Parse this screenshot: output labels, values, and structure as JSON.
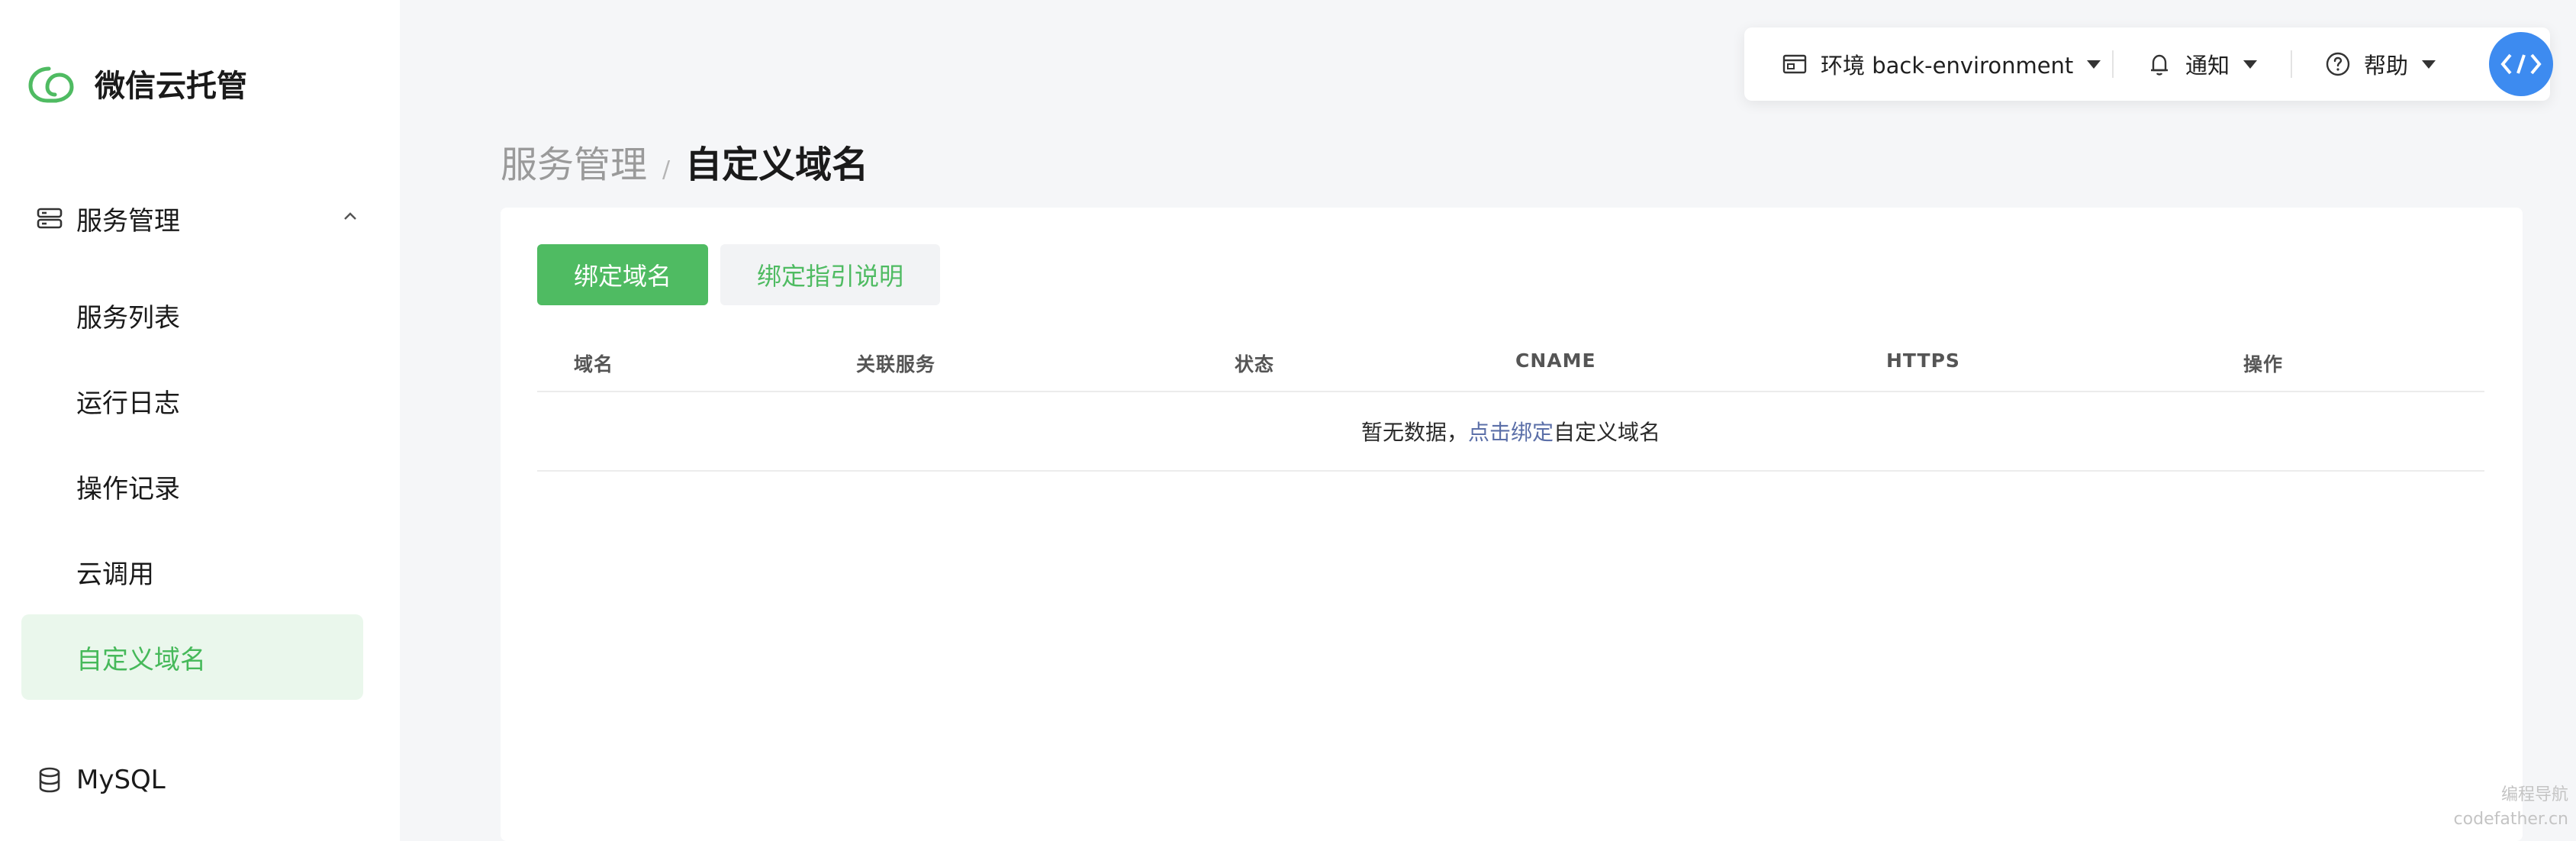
{
  "app": {
    "title": "微信云托管"
  },
  "colors": {
    "accent": "#4fbb62",
    "accent_bg": "#eaf7ec",
    "link": "#5b6fa8",
    "avatar": "#3d8bf0"
  },
  "sidebar": {
    "group": {
      "label": "服务管理",
      "icon": "server-icon",
      "expanded": true
    },
    "items": [
      {
        "label": "服务列表",
        "active": false
      },
      {
        "label": "运行日志",
        "active": false
      },
      {
        "label": "操作记录",
        "active": false
      },
      {
        "label": "云调用",
        "active": false
      },
      {
        "label": "自定义域名",
        "active": true
      }
    ],
    "mysql": {
      "label": "MySQL",
      "icon": "database-icon"
    }
  },
  "topbar": {
    "environment": {
      "label": "环境 back-environment",
      "icon": "environment-icon"
    },
    "notify": {
      "label": "通知",
      "icon": "bell-icon"
    },
    "help": {
      "label": "帮助",
      "icon": "help-icon"
    }
  },
  "breadcrumb": {
    "parent": "服务管理",
    "separator": "/",
    "current": "自定义域名"
  },
  "actions": {
    "bind_domain": "绑定域名",
    "bind_guide": "绑定指引说明"
  },
  "table": {
    "columns": [
      "域名",
      "关联服务",
      "状态",
      "CNAME",
      "HTTPS",
      "操作"
    ],
    "empty": {
      "prefix": "暂无数据，",
      "link": "点击绑定",
      "suffix": "自定义域名"
    }
  },
  "watermark": {
    "line1": "编程导航",
    "line2": "codefather.cn"
  }
}
